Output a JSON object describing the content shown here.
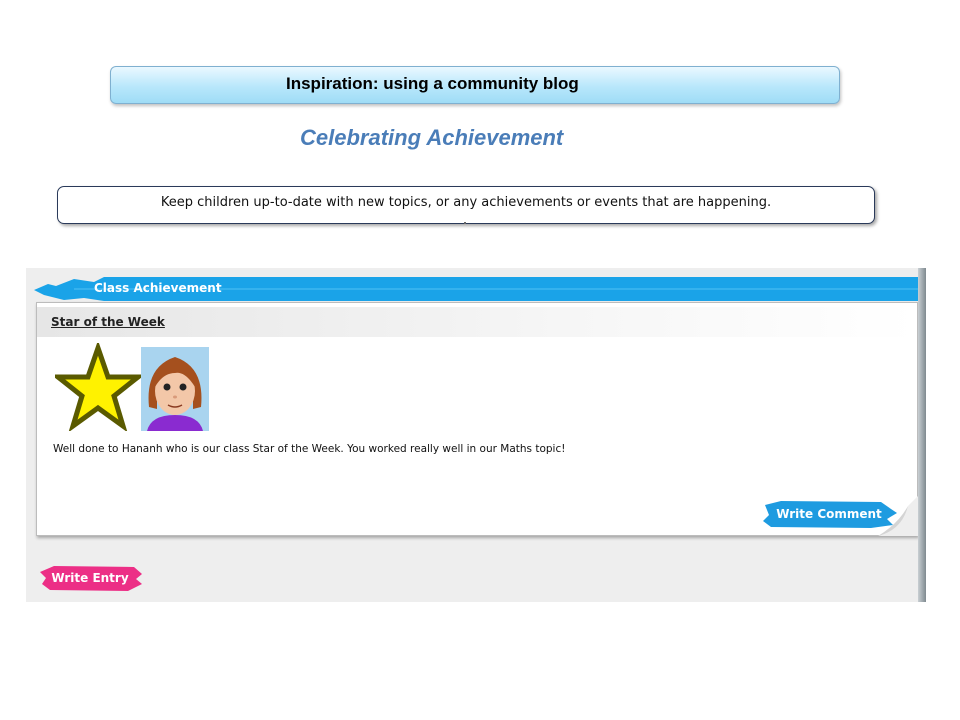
{
  "slide": {
    "title": "Inspiration:  using  a community  blog",
    "subtitle": "Celebrating Achievement",
    "description": "Keep children up-to-date with new topics, or any achievements or events that are happening."
  },
  "blog": {
    "header": "Class Achievement",
    "post": {
      "title": "Star of the Week",
      "body": "Well done to Hananh who is our class Star of the Week. You worked really well in our Maths topic!",
      "comment_button": "Write Comment"
    },
    "entry_button": "Write Entry"
  },
  "colors": {
    "header_blue": "#1aa3e8",
    "comment_blue": "#1e9be0",
    "entry_pink": "#ec2f86",
    "subtitle_blue": "#4a7db8",
    "star_fill": "#fff200",
    "star_outline": "#5a5a00"
  }
}
